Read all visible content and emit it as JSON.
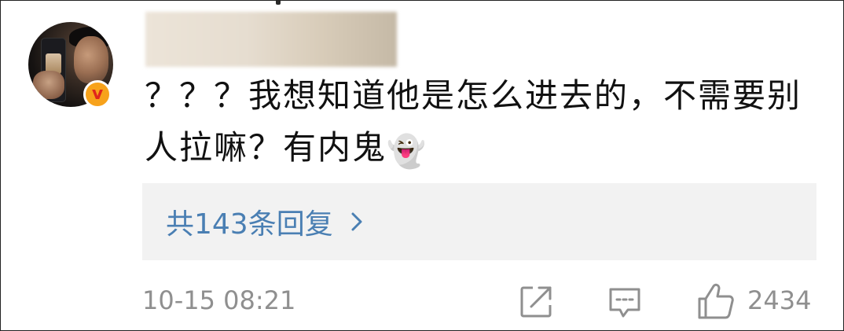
{
  "comment": {
    "line1": "？？？我想知道他是怎么进去的，不需要别",
    "line2": "人拉嘛？有内鬼",
    "emoji": "👻"
  },
  "avatar": {
    "badge_letter": "v",
    "badge_color": "#f7a21b"
  },
  "replies": {
    "label": "共143条回复"
  },
  "footer": {
    "timestamp": "10-15 08:21",
    "like_count": "2434"
  },
  "colors": {
    "link": "#4a7fb3",
    "muted": "#8f8f8f",
    "text": "#111111",
    "reply_bg": "#f2f2f2"
  }
}
